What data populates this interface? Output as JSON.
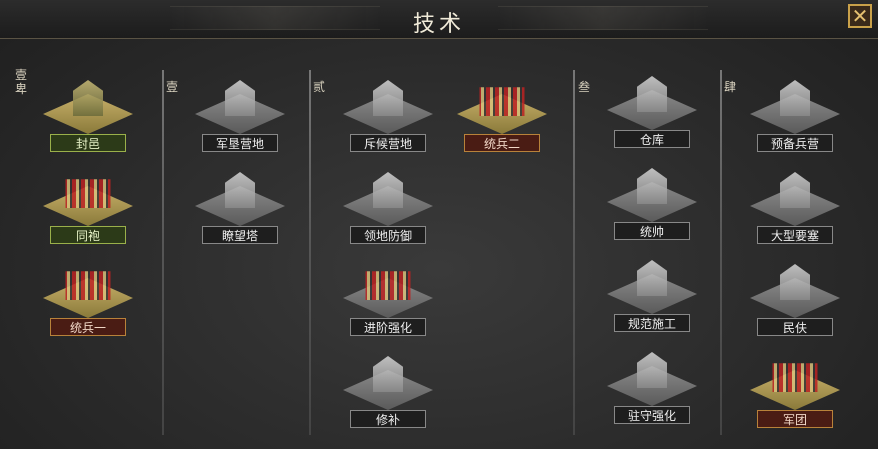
{
  "title": "技术",
  "close_label": "✕",
  "tiers": [
    {
      "label": "壹\n卑"
    },
    {
      "label": "壹"
    },
    {
      "label": "贰"
    },
    {
      "label": "叁"
    },
    {
      "label": "肆"
    }
  ],
  "nodes": [
    {
      "label": "封邑"
    },
    {
      "label": "同袍"
    },
    {
      "label": "统兵一"
    },
    {
      "label": "军垦营地"
    },
    {
      "label": "瞭望塔"
    },
    {
      "label": "斥候营地"
    },
    {
      "label": "统兵二"
    },
    {
      "label": "领地防御"
    },
    {
      "label": "进阶强化"
    },
    {
      "label": "修补"
    },
    {
      "label": "仓库"
    },
    {
      "label": "统帅"
    },
    {
      "label": "规范施工"
    },
    {
      "label": "驻守强化"
    },
    {
      "label": "预备兵营"
    },
    {
      "label": "大型要塞"
    },
    {
      "label": "民伕"
    },
    {
      "label": "军团"
    }
  ]
}
